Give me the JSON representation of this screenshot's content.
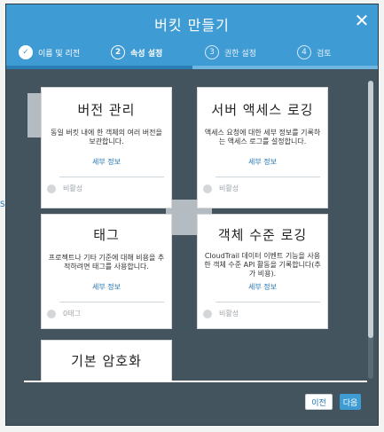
{
  "background": {
    "top_text": "",
    "edge_text": "S"
  },
  "modal": {
    "title": "버킷 만들기",
    "close_icon": "close-icon",
    "steps": [
      {
        "number": "1",
        "label": "이름 및 리전",
        "state": "done"
      },
      {
        "number": "2",
        "label": "속성 설정",
        "state": "active"
      },
      {
        "number": "3",
        "label": "권한 설정",
        "state": "inactive"
      },
      {
        "number": "4",
        "label": "검토",
        "state": "inactive"
      }
    ],
    "progress_fraction": 0.5,
    "cards": [
      {
        "title": "버전 관리",
        "description": "동일 버킷 내에 한 객체의 여러 버전을 보관합니다.",
        "more_link": "세부 정보",
        "status": "비활성"
      },
      {
        "title": "서버 액세스 로깅",
        "description": "액세스 요청에 대한 세부 정보를 기록하는 액세스 로그를 설정합니다.",
        "more_link": "세부 정보",
        "status": "비활성"
      },
      {
        "title": "태그",
        "description": "프로젝트나 기타 기준에 대해 비용을 추적하려면 태그를 사용합니다.",
        "more_link": "세부 정보",
        "status": "0태그"
      },
      {
        "title": "객체 수준 로깅",
        "description": "CloudTrail 데이터 이벤트 기능을 사용한 객체 수준 API 활동을 기록합니다(추가 비용).",
        "more_link": "세부 정보",
        "status": "비활성"
      },
      {
        "title": "기본 암호화",
        "description": "",
        "more_link": "",
        "status": ""
      }
    ],
    "footer": {
      "prev_label": "이전",
      "next_label": "다음"
    }
  }
}
